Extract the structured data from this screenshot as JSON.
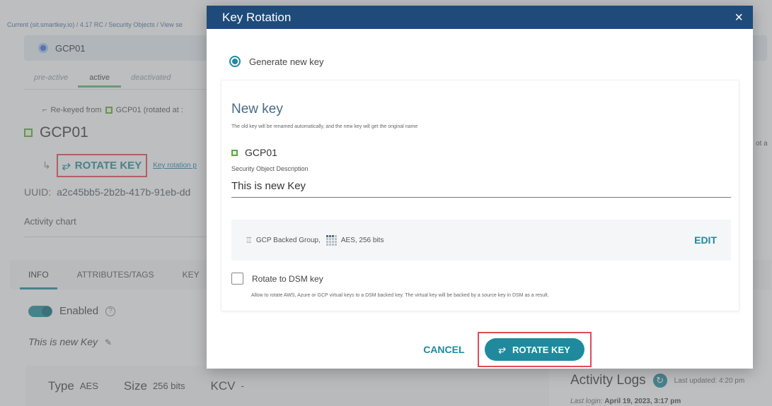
{
  "background": {
    "breadcrumb": "Current (sit.smartkey.io) / 4.17 RC / Security Objects / View se",
    "object_header": "GCP01",
    "state_tabs": [
      "pre-active",
      "active",
      "deactivated"
    ],
    "rekeyed_text": "Re-keyed from",
    "rekeyed_suffix": "GCP01 (rotated at :",
    "key_name": "GCP01",
    "rotate_key_label": "ROTATE KEY",
    "rotation_link": "Key rotation p",
    "uuid_label": "UUID:",
    "uuid_value": "a2c45bb5-2b2b-417b-91eb-dd",
    "activity_chart": "Activity chart",
    "tabs": [
      "INFO",
      "ATTRIBUTES/TAGS",
      "KEY"
    ],
    "enabled_label": "Enabled",
    "description": "This is new Key",
    "type_label": "Type",
    "type_value": "AES",
    "size_label": "Size",
    "size_value": "256 bits",
    "kcv_label": "KCV",
    "kcv_value": "-",
    "activity_logs": "Activity Logs",
    "last_updated": "Last updated: 4:20 pm",
    "last_login_label": "Last login:",
    "last_login_value": "April 19, 2023, 3:17 pm",
    "right_edge_text": "ot a"
  },
  "modal": {
    "title": "Key Rotation",
    "close_symbol": "×",
    "radio_label": "Generate new key",
    "card_title": "New key",
    "card_subtitle": "The old key will be renamed automatically, and the new key will get the original name",
    "key_name": "GCP01",
    "description_label": "Security Object Description",
    "description_value": "This is new Key",
    "group_text": "GCP Backed Group,",
    "algo_text": "AES, 256 bits",
    "edit_label": "EDIT",
    "checkbox_label": "Rotate to DSM key",
    "checkbox_help": "Allow to rotate AWS, Azure or GCP virtual keys to a DSM backed key. The virtual key will be backed by a source key in DSM as a result.",
    "cancel_label": "CANCEL",
    "rotate_label": "ROTATE KEY"
  }
}
